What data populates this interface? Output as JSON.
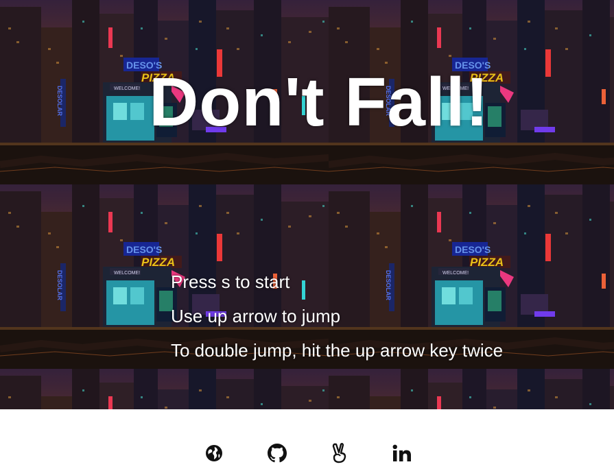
{
  "game": {
    "title": "Don't Fall!",
    "instructions": [
      "Press s to start",
      "Use up arrow to jump",
      "To double jump, hit the up arrow key twice"
    ],
    "background_signs": {
      "shop": "DESO'S",
      "pizza": "PIZZA",
      "welcome": "WELCOME!",
      "vertical": "DESOLAR"
    }
  },
  "footer": {
    "links": [
      {
        "icon": "globe-icon"
      },
      {
        "icon": "github-icon"
      },
      {
        "icon": "angellist-icon"
      },
      {
        "icon": "linkedin-icon"
      }
    ]
  },
  "colors": {
    "sky_top": "#2a1a3a",
    "glow_orange": "#c8642a",
    "neon_cyan": "#39e6e6",
    "neon_pink": "#ff3d8a",
    "neon_yellow": "#ffd21a",
    "sign_blue": "#3a5cff"
  }
}
